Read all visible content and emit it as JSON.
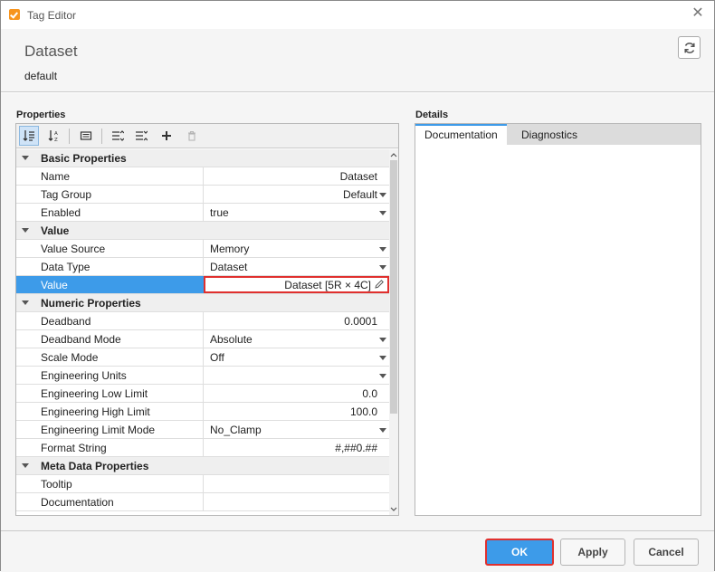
{
  "window": {
    "title": "Tag Editor"
  },
  "header": {
    "title": "Dataset",
    "subtitle": "default"
  },
  "properties_panel": {
    "label": "Properties",
    "categories": [
      {
        "name": "Basic Properties",
        "rows": [
          {
            "name": "Name",
            "value": "Dataset",
            "align": "right",
            "dropdown": false
          },
          {
            "name": "Tag Group",
            "value": "Default",
            "align": "right",
            "dropdown": true
          },
          {
            "name": "Enabled",
            "value": "true",
            "align": "left",
            "dropdown": true
          }
        ]
      },
      {
        "name": "Value",
        "rows": [
          {
            "name": "Value Source",
            "value": "Memory",
            "align": "left",
            "dropdown": true
          },
          {
            "name": "Data Type",
            "value": "Dataset",
            "align": "left",
            "dropdown": true
          },
          {
            "name": "Value",
            "value": "Dataset [5R × 4C]",
            "align": "right",
            "dropdown": false,
            "selected": true,
            "editable": true
          }
        ]
      },
      {
        "name": "Numeric Properties",
        "rows": [
          {
            "name": "Deadband",
            "value": "0.0001",
            "align": "right",
            "dropdown": false
          },
          {
            "name": "Deadband Mode",
            "value": "Absolute",
            "align": "left",
            "dropdown": true
          },
          {
            "name": "Scale Mode",
            "value": "Off",
            "align": "left",
            "dropdown": true
          },
          {
            "name": "Engineering Units",
            "value": "",
            "align": "left",
            "dropdown": true
          },
          {
            "name": "Engineering Low Limit",
            "value": "0.0",
            "align": "right",
            "dropdown": false
          },
          {
            "name": "Engineering High Limit",
            "value": "100.0",
            "align": "right",
            "dropdown": false
          },
          {
            "name": "Engineering Limit Mode",
            "value": "No_Clamp",
            "align": "left",
            "dropdown": true
          },
          {
            "name": "Format String",
            "value": "#,##0.##",
            "align": "right",
            "dropdown": false
          }
        ]
      },
      {
        "name": "Meta Data Properties",
        "rows": [
          {
            "name": "Tooltip",
            "value": "",
            "align": "left",
            "dropdown": false
          },
          {
            "name": "Documentation",
            "value": "",
            "align": "left",
            "dropdown": false
          }
        ]
      }
    ]
  },
  "details_panel": {
    "label": "Details",
    "tabs": [
      {
        "label": "Documentation",
        "active": true
      },
      {
        "label": "Diagnostics",
        "active": false
      }
    ]
  },
  "footer": {
    "ok_label": "OK",
    "apply_label": "Apply",
    "cancel_label": "Cancel"
  },
  "colors": {
    "accent": "#3d9be9",
    "highlight_border": "#e0302e",
    "app_icon": "#f7941d"
  }
}
